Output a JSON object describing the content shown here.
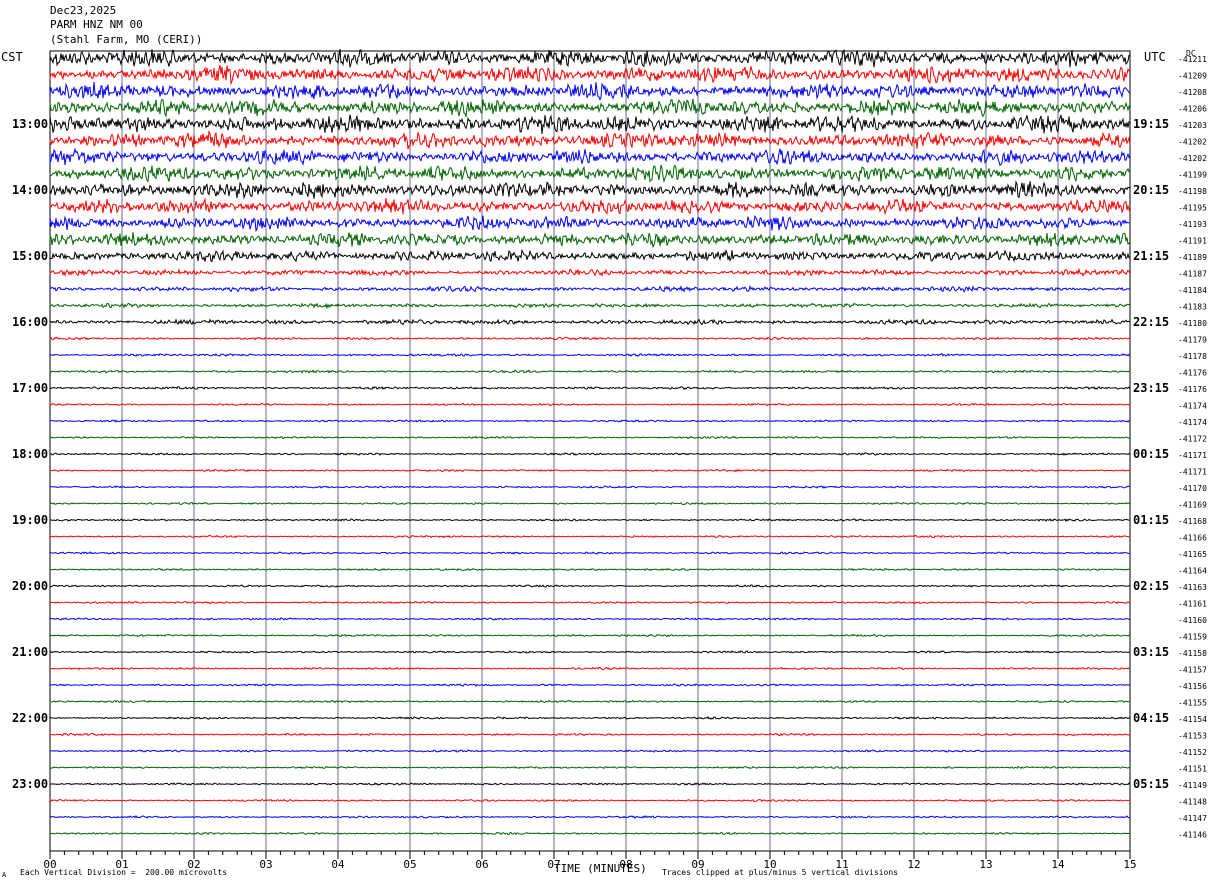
{
  "header": {
    "date": "Dec23,2025",
    "station": "PARM HNZ NM 00",
    "location": "(Stahl Farm, MO (CERI))"
  },
  "labels": {
    "left_zone": "CST",
    "right_zone": "UTC",
    "dc": "DC",
    "x_title": "TIME (MINUTES)",
    "scale_note": "Each Vertical Division =  200.00 microvolts",
    "clip_note": "Traces clipped at plus/minus 5 vertical divisions",
    "corner_mark": "A"
  },
  "chart_data": {
    "type": "line",
    "title": "PARM HNZ NM 00",
    "xlabel": "TIME (MINUTES)",
    "ylabel": "",
    "xlim": [
      0,
      15
    ],
    "x_ticks": [
      "00",
      "01",
      "02",
      "03",
      "04",
      "05",
      "06",
      "07",
      "08",
      "09",
      "10",
      "11",
      "12",
      "13",
      "14",
      "15"
    ],
    "left_hour_labels": [
      "13:00",
      "14:00",
      "15:00",
      "16:00",
      "17:00",
      "18:00",
      "19:00",
      "20:00",
      "21:00",
      "22:00",
      "23:00"
    ],
    "right_hour_labels": [
      "19:15",
      "20:15",
      "21:15",
      "22:15",
      "23:15",
      "00:15",
      "01:15",
      "02:15",
      "03:15",
      "04:15",
      "05:15"
    ],
    "trace_colors": [
      "#000000",
      "#ff0000",
      "#0000ff",
      "#006400"
    ],
    "dc_offsets": [
      "-41211",
      "-41209",
      "-41208",
      "-41206",
      "-41203",
      "-41202",
      "-41202",
      "-41199",
      "-41198",
      "-41195",
      "-41193",
      "-41191",
      "-41189",
      "-41187",
      "-41184",
      "-41183",
      "-41180",
      "-41179",
      "-41178",
      "-41176",
      "-41176",
      "-41174",
      "-41174",
      "-41172",
      "-41171",
      "-41171",
      "-41170",
      "-41169",
      "-41168",
      "-41166",
      "-41165",
      "-41164",
      "-41163",
      "-41161",
      "-41160",
      "-41159",
      "-41158",
      "-41157",
      "-41156",
      "-41155",
      "-41154",
      "-41153",
      "-41152",
      "-41151",
      "-41149",
      "-41148",
      "-41147",
      "-41146"
    ],
    "trace_activity": [
      0.9,
      0.85,
      0.8,
      0.85,
      0.9,
      0.8,
      0.75,
      0.8,
      0.8,
      0.75,
      0.7,
      0.7,
      0.55,
      0.3,
      0.25,
      0.2,
      0.25,
      0.12,
      0.12,
      0.12,
      0.12,
      0.1,
      0.1,
      0.1,
      0.1,
      0.1,
      0.1,
      0.1,
      0.1,
      0.1,
      0.1,
      0.1,
      0.1,
      0.1,
      0.1,
      0.1,
      0.1,
      0.1,
      0.1,
      0.1,
      0.1,
      0.1,
      0.1,
      0.1,
      0.1,
      0.1,
      0.1,
      0.1
    ],
    "grid": true
  }
}
